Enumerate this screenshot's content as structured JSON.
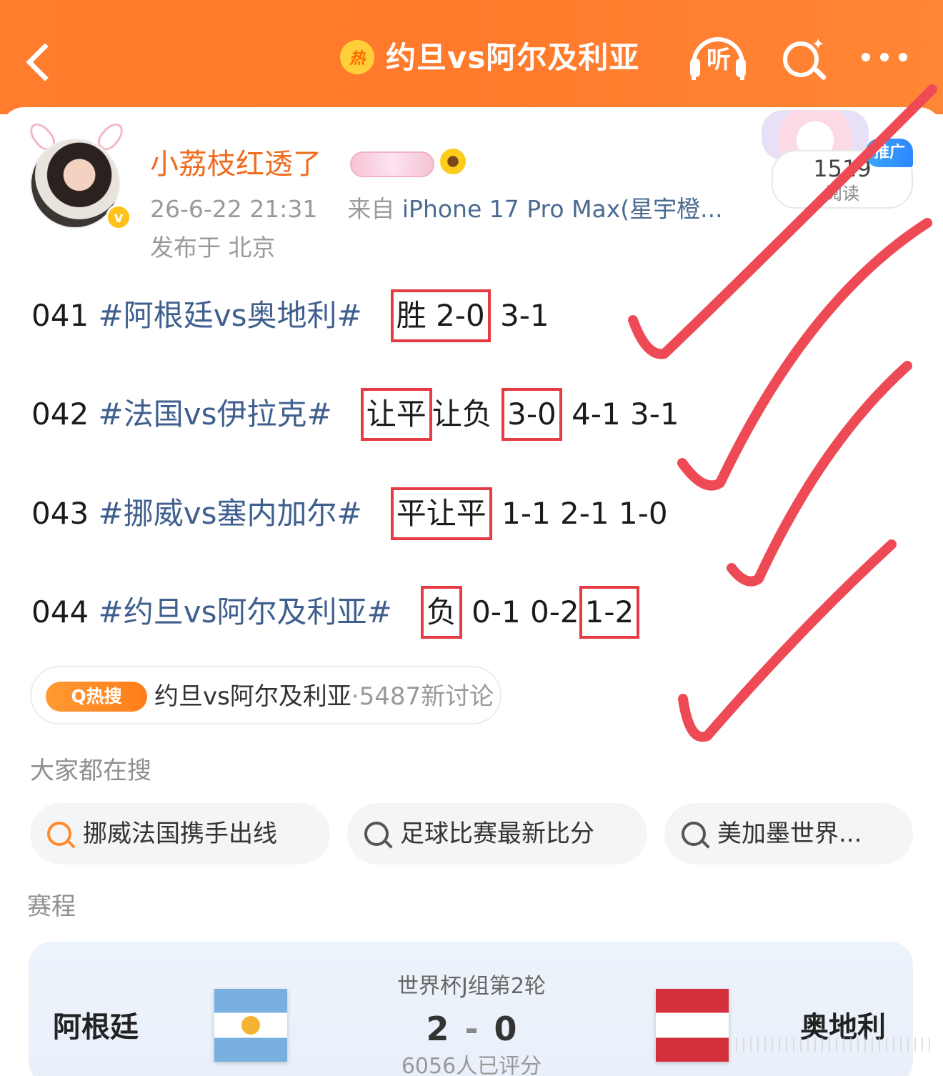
{
  "header": {
    "title": "约旦vs阿尔及利亚",
    "hot_badge": "热",
    "listen_label": "听"
  },
  "post": {
    "username": "小荔枝红透了",
    "timestamp": "26-6-22 21:31",
    "source_prefix": "来自",
    "device": "iPhone 17 Pro Max(星宇橙...",
    "location": "发布于 北京",
    "read_count": "1519",
    "read_label": "阅读",
    "promo_tag": "推广",
    "lines": [
      {
        "num": "041",
        "tag": "#阿根廷vs奥地利#",
        "boxed1": "胜 2-0",
        "rest": "3-1"
      },
      {
        "num": "042",
        "tag": "#法国vs伊拉克#",
        "boxed1": "让平",
        "mid": "让负",
        "boxed2": "3-0",
        "rest": "4-1 3-1"
      },
      {
        "num": "043",
        "tag": "#挪威vs塞内加尔#",
        "boxed1": "平让平",
        "rest": "1-1 2-1 1-0"
      },
      {
        "num": "044",
        "tag": "#约旦vs阿尔及利亚#",
        "boxed1": "负",
        "mid": "0-1 0-2",
        "boxed2": "1-2"
      }
    ],
    "hot_search": {
      "label": "Q热搜",
      "topic": "约旦vs阿尔及利亚",
      "count": "·5487新讨论"
    }
  },
  "everyone_search": {
    "title": "大家都在搜",
    "chips": [
      "挪威法国携手出线",
      "足球比赛最新比分",
      "美加墨世界..."
    ]
  },
  "schedule": {
    "title": "赛程",
    "round": "世界杯J组第2轮",
    "home": "阿根廷",
    "away": "奥地利",
    "home_score": "2",
    "away_score": "0",
    "dash": "-",
    "rating": "6056人已评分"
  },
  "colors": {
    "header": "#ff7d2c",
    "username": "#ef6b1d",
    "topic": "#3f5f8f",
    "annotation": "#e63a44"
  }
}
